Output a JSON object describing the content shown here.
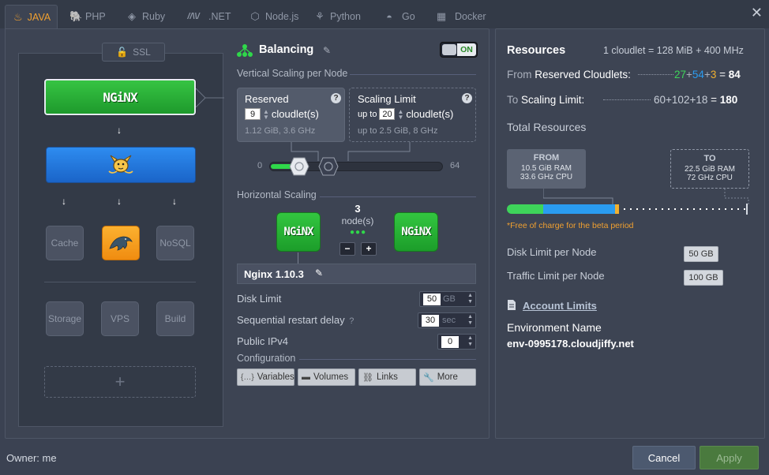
{
  "tabs": [
    {
      "label": "JAVA",
      "icon": "java-icon"
    },
    {
      "label": "PHP",
      "icon": "php-icon"
    },
    {
      "label": "Ruby",
      "icon": "ruby-icon"
    },
    {
      "label": ".NET",
      "icon": "dotnet-icon"
    },
    {
      "label": "Node.js",
      "icon": "nodejs-icon"
    },
    {
      "label": "Python",
      "icon": "python-icon"
    },
    {
      "label": "Go",
      "icon": "go-icon"
    },
    {
      "label": "Docker",
      "icon": "docker-icon"
    }
  ],
  "close_label": "✕",
  "topology": {
    "ssl_label": "SSL",
    "nginx_logo": "NGiNX",
    "cache_label": "Cache",
    "nosql_label": "NoSQL",
    "storage_label": "Storage",
    "vps_label": "VPS",
    "build_label": "Build",
    "add_label": "+"
  },
  "balancing": {
    "title": "Balancing",
    "toggle_label": "ON",
    "vertical_title": "Vertical Scaling per Node",
    "reserved": {
      "title": "Reserved",
      "value": "9",
      "unit": "cloudlet(s)",
      "specs": "1.12 GiB, 3.6 GHz"
    },
    "limit": {
      "title": "Scaling Limit",
      "prefix": "up to",
      "value": "20",
      "unit": "cloudlet(s)",
      "specs": "up to 2.5 GiB, 8 GHz"
    },
    "slider_min": "0",
    "slider_max": "64",
    "horizontal_title": "Horizontal Scaling",
    "node_count": "3",
    "node_unit": "node(s)",
    "minus": "−",
    "plus": "+",
    "version": "Nginx 1.10.3",
    "disk_limit": {
      "label": "Disk Limit",
      "value": "50",
      "unit": "GB"
    },
    "restart_delay": {
      "label": "Sequential restart delay",
      "value": "30",
      "unit": "sec"
    },
    "public_ipv4": {
      "label": "Public IPv4",
      "value": "0"
    },
    "configuration_title": "Configuration",
    "config_buttons": [
      "Variables",
      "Volumes",
      "Links",
      "More"
    ]
  },
  "resources": {
    "title": "Resources",
    "cloudlet_def": "1 cloudlet = 128 MiB + 400 MHz",
    "reserved_prefix": "From",
    "reserved_label": "Reserved Cloudlets:",
    "reserved_parts": [
      "27",
      "54",
      "3"
    ],
    "reserved_total": "84",
    "limit_prefix": "To",
    "limit_label": "Scaling Limit:",
    "limit_parts": [
      "60",
      "102",
      "18"
    ],
    "limit_total": "180",
    "total_title": "Total Resources",
    "from_box": {
      "title": "FROM",
      "ram": "10.5 GiB RAM",
      "cpu": "33.6 GHz CPU"
    },
    "to_box": {
      "title": "TO",
      "ram": "22.5 GiB RAM",
      "cpu": "72 GHz CPU"
    },
    "free_note": "*Free of charge for the beta period",
    "disk_limit_label": "Disk Limit per Node",
    "disk_limit_value": "50 GB",
    "traffic_limit_label": "Traffic Limit per Node",
    "traffic_limit_value": "100 GB",
    "account_limits": "Account Limits",
    "env_name_label": "Environment Name",
    "env_name_value": "env-0995178.cloudjiffy.net",
    "colors": {
      "green": "#3ed45a",
      "blue": "#2a9cf0",
      "orange": "#f0b030"
    }
  },
  "footer": {
    "owner": "Owner: me",
    "cancel": "Cancel",
    "apply": "Apply"
  }
}
